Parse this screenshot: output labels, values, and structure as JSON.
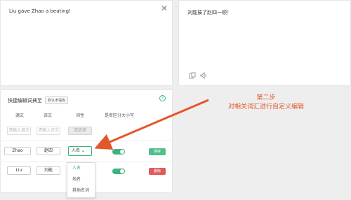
{
  "source": {
    "text": "Liu  gave Zhao a beating!",
    "close_icon": "close-icon"
  },
  "target": {
    "text": "刘能揍了赵四一顿！",
    "icons": [
      "copy-icon",
      "speaker-icon"
    ]
  },
  "dict": {
    "title": "快捷编辑词典至",
    "library_badge": "默认术语库",
    "help_glyph": "?",
    "columns": [
      "源文",
      "译文",
      "词性",
      "是否区分大小写"
    ],
    "new_row": {
      "source_placeholder": "请输入源文",
      "target_placeholder": "请输入译文",
      "pos_placeholder": "请选择"
    },
    "rows": [
      {
        "source": "Zhao",
        "target": "赵四",
        "pos": "人名 ⌄",
        "case_sensitive": true,
        "action": "保存"
      },
      {
        "source": "Liu",
        "target": "刘能",
        "pos": "人名",
        "case_sensitive": true,
        "action": "删除"
      }
    ],
    "dropdown": [
      "人名",
      "地名",
      "其他名词"
    ]
  },
  "annotation": {
    "line1": "第二步",
    "line2": "对相关词汇进行自定义编辑"
  },
  "colors": {
    "accent": "#3fb27f",
    "danger": "#e05a5a",
    "annotation": "#e2572b"
  }
}
